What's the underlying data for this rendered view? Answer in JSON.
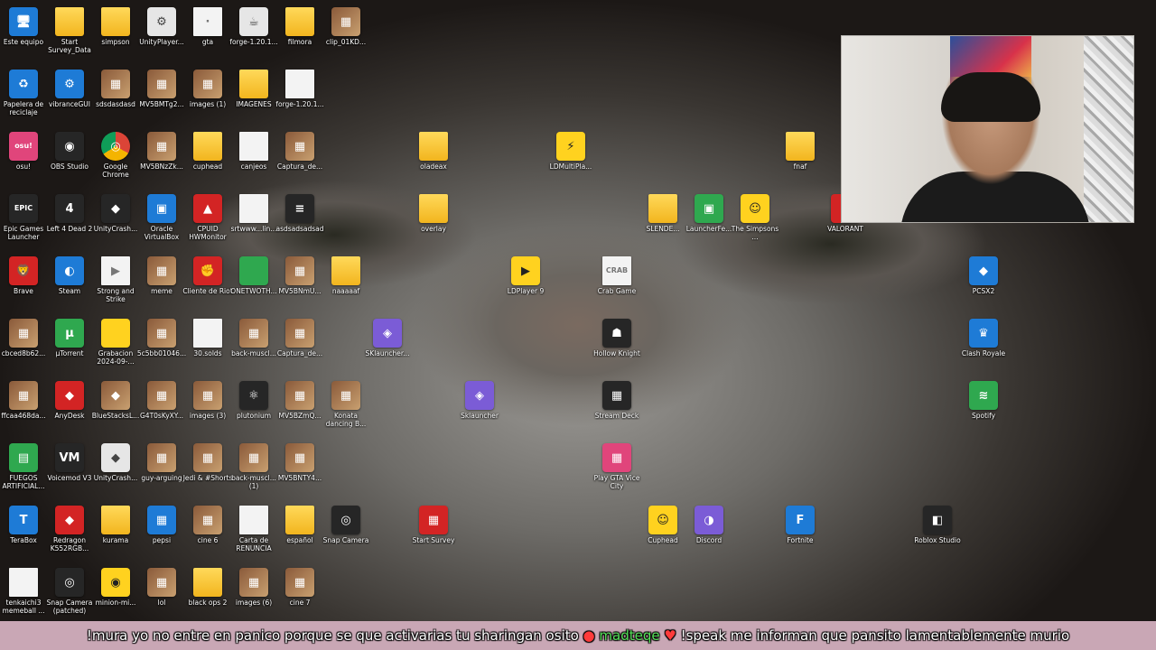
{
  "desktop": {
    "icons": [
      {
        "label": "Este equipo",
        "kind": "blue",
        "glyph": "🖥"
      },
      {
        "label": "Start Survey_Data",
        "kind": "folder",
        "glyph": ""
      },
      {
        "label": "simpson",
        "kind": "folder",
        "glyph": ""
      },
      {
        "label": "UnityPlayer...",
        "kind": "exe",
        "glyph": "⚙"
      },
      {
        "label": "gta",
        "kind": "file",
        "glyph": "·"
      },
      {
        "label": "forge-1.20.1...",
        "kind": "exe",
        "glyph": "☕"
      },
      {
        "label": "filmora",
        "kind": "folder",
        "glyph": ""
      },
      {
        "label": "clip_01KD...",
        "kind": "img",
        "glyph": "▦"
      },
      {
        "label": "Papelera de reciclaje",
        "kind": "blue",
        "glyph": "♻"
      },
      {
        "label": "vibranceGUI",
        "kind": "blue",
        "glyph": "⚙"
      },
      {
        "label": "sdsdasdasd",
        "kind": "img",
        "glyph": "▦"
      },
      {
        "label": "MV5BMTg2...",
        "kind": "img",
        "glyph": "▦"
      },
      {
        "label": "images (1)",
        "kind": "img",
        "glyph": "▦"
      },
      {
        "label": "IMAGENES",
        "kind": "folder",
        "glyph": ""
      },
      {
        "label": "forge-1.20.1...",
        "kind": "file",
        "glyph": ""
      },
      {
        "label": "osu!",
        "kind": "pink",
        "glyph": "osu!"
      },
      {
        "label": "OBS Studio",
        "kind": "dark",
        "glyph": "◉"
      },
      {
        "label": "Google Chrome",
        "kind": "chrome",
        "glyph": "◎"
      },
      {
        "label": "MV5BNzZk...",
        "kind": "img",
        "glyph": "▦"
      },
      {
        "label": "cuphead",
        "kind": "folder",
        "glyph": ""
      },
      {
        "label": "canjeos",
        "kind": "file",
        "glyph": ""
      },
      {
        "label": "Captura_de...",
        "kind": "img",
        "glyph": "▦"
      },
      {
        "label": "Epic Games Launcher",
        "kind": "dark",
        "glyph": "EPIC"
      },
      {
        "label": "Left 4 Dead 2",
        "kind": "dark",
        "glyph": "4"
      },
      {
        "label": "UnityCrash...",
        "kind": "dark",
        "glyph": "◆"
      },
      {
        "label": "Oracle VirtualBox",
        "kind": "blue",
        "glyph": "▣"
      },
      {
        "label": "CPUID HWMonitor",
        "kind": "red",
        "glyph": "▲"
      },
      {
        "label": "srtwww...lin...",
        "kind": "file",
        "glyph": ""
      },
      {
        "label": "asdsadsadsad",
        "kind": "dark",
        "glyph": "≡"
      },
      {
        "label": "Brave",
        "kind": "red",
        "glyph": "🦁"
      },
      {
        "label": "Steam",
        "kind": "blue",
        "glyph": "◐"
      },
      {
        "label": "Strong and Strike",
        "kind": "file",
        "glyph": "▶"
      },
      {
        "label": "meme",
        "kind": "img",
        "glyph": "▦"
      },
      {
        "label": "Cliente de Riot",
        "kind": "red",
        "glyph": "✊"
      },
      {
        "label": "ONETWOTH...",
        "kind": "green",
        "glyph": ""
      },
      {
        "label": "MV5BNmU...",
        "kind": "img",
        "glyph": "▦"
      },
      {
        "label": "naaaaaf",
        "kind": "folder",
        "glyph": ""
      },
      {
        "label": "cbced8b62...",
        "kind": "img",
        "glyph": "▦"
      },
      {
        "label": "µTorrent",
        "kind": "green",
        "glyph": "µ"
      },
      {
        "label": "Grabacion 2024-09-...",
        "kind": "yellow",
        "glyph": ""
      },
      {
        "label": "5c5bb01046...",
        "kind": "img",
        "glyph": "▦"
      },
      {
        "label": "30.solds",
        "kind": "file",
        "glyph": ""
      },
      {
        "label": "back-muscl...",
        "kind": "img",
        "glyph": "▦"
      },
      {
        "label": "Captura_de...",
        "kind": "img",
        "glyph": "▦"
      },
      {
        "label": "ffcaa468da...",
        "kind": "img",
        "glyph": "▦"
      },
      {
        "label": "AnyDesk",
        "kind": "red",
        "glyph": "◆"
      },
      {
        "label": "BlueStacksL...",
        "kind": "img",
        "glyph": "◆"
      },
      {
        "label": "G4T0sKyXY...",
        "kind": "img",
        "glyph": "▦"
      },
      {
        "label": "images (3)",
        "kind": "img",
        "glyph": "▦"
      },
      {
        "label": "plutonium",
        "kind": "dark",
        "glyph": "⚛"
      },
      {
        "label": "MV5BZmQ...",
        "kind": "img",
        "glyph": "▦"
      },
      {
        "label": "Konata dancing B...",
        "kind": "img",
        "glyph": "▦"
      },
      {
        "label": "FUEGOS ARTIFICIAL...",
        "kind": "green",
        "glyph": "▤"
      },
      {
        "label": "Voicemod V3",
        "kind": "dark",
        "glyph": "VM"
      },
      {
        "label": "UnityCrash...",
        "kind": "exe",
        "glyph": "◆"
      },
      {
        "label": "guy-arguing",
        "kind": "img",
        "glyph": "▦"
      },
      {
        "label": "Jedi & #Shorts",
        "kind": "img",
        "glyph": "▦"
      },
      {
        "label": "back-muscl... (1)",
        "kind": "img",
        "glyph": "▦"
      },
      {
        "label": "MV5BNTY4...",
        "kind": "img",
        "glyph": "▦"
      },
      {
        "label": "TeraBox",
        "kind": "blue",
        "glyph": "T"
      },
      {
        "label": "Redragon K552RGB...",
        "kind": "red",
        "glyph": "◆"
      },
      {
        "label": "kurama",
        "kind": "folder",
        "glyph": ""
      },
      {
        "label": "pepsi",
        "kind": "blue",
        "glyph": "▦"
      },
      {
        "label": "cine 6",
        "kind": "img",
        "glyph": "▦"
      },
      {
        "label": "Carta de RENUNCIA",
        "kind": "file",
        "glyph": ""
      },
      {
        "label": "español",
        "kind": "folder",
        "glyph": ""
      },
      {
        "label": "Snap Camera",
        "kind": "dark",
        "glyph": "◎"
      },
      {
        "label": "tenkaichi3 memeball ...",
        "kind": "file",
        "glyph": ""
      },
      {
        "label": "Snap Camera (patched)",
        "kind": "dark",
        "glyph": "◎"
      },
      {
        "label": "minion-mi...",
        "kind": "yellow",
        "glyph": "◉"
      },
      {
        "label": "lol",
        "kind": "img",
        "glyph": "▦"
      },
      {
        "label": "black ops 2",
        "kind": "folder",
        "glyph": ""
      },
      {
        "label": "images (6)",
        "kind": "img",
        "glyph": "▦"
      },
      {
        "label": "cine 7",
        "kind": "img",
        "glyph": "▦"
      },
      {
        "label": "oladeax",
        "kind": "folder",
        "glyph": ""
      },
      {
        "label": "LDMultiPla...",
        "kind": "yellow",
        "glyph": "⚡"
      },
      {
        "label": "fnaf",
        "kind": "folder",
        "glyph": ""
      },
      {
        "label": "overlay",
        "kind": "folder",
        "glyph": ""
      },
      {
        "label": "SLENDE...",
        "kind": "folder",
        "glyph": ""
      },
      {
        "label": "LauncherFe...",
        "kind": "green",
        "glyph": "▣"
      },
      {
        "label": "The Simpsons ...",
        "kind": "yellow",
        "glyph": "☺"
      },
      {
        "label": "VALORANT",
        "kind": "red",
        "glyph": "V"
      },
      {
        "label": "LDPlayer 9",
        "kind": "yellow",
        "glyph": "▶"
      },
      {
        "label": "Crab Game",
        "kind": "file",
        "glyph": "CRAB"
      },
      {
        "label": "PCSX2",
        "kind": "blue",
        "glyph": "◆"
      },
      {
        "label": "SKlauncher...",
        "kind": "purple",
        "glyph": "◈"
      },
      {
        "label": "Hollow Knight",
        "kind": "dark",
        "glyph": "☗"
      },
      {
        "label": "Clash Royale",
        "kind": "blue",
        "glyph": "♛"
      },
      {
        "label": "Sklauncher",
        "kind": "purple",
        "glyph": "◈"
      },
      {
        "label": "Stream Deck",
        "kind": "dark",
        "glyph": "▦"
      },
      {
        "label": "Spotify",
        "kind": "green",
        "glyph": "≋"
      },
      {
        "label": "Play GTA Vice City",
        "kind": "pink",
        "glyph": "▦"
      },
      {
        "label": "Start Survey",
        "kind": "red",
        "glyph": "▦"
      },
      {
        "label": "Cuphead",
        "kind": "yellow",
        "glyph": "☺"
      },
      {
        "label": "Discord",
        "kind": "purple",
        "glyph": "◑"
      },
      {
        "label": "Fortnite",
        "kind": "blue",
        "glyph": "F"
      },
      {
        "label": "Roblox Studio",
        "kind": "dark",
        "glyph": "◧"
      }
    ]
  },
  "ticker": {
    "part1": "!mura yo no entre en panico porque se que activarias tu sharingan osito",
    "user": "madteqe",
    "part2": "!speak me informan que pansito lamentablemente murio"
  }
}
